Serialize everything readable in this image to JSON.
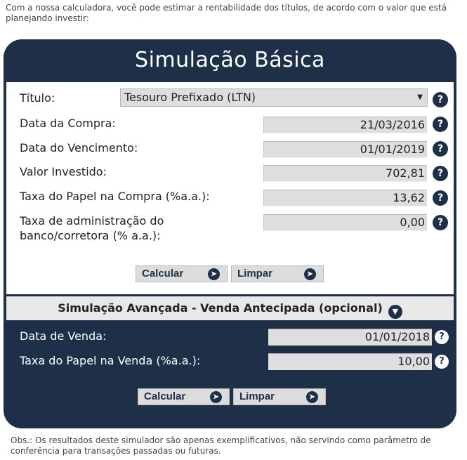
{
  "intro": "Com a nossa calculadora, você pode estimar a rentabilidade dos títulos, de acordo com o valor que está planejando investir:",
  "basic": {
    "title": "Simulação Básica",
    "titulo_label": "Título:",
    "titulo_value": "Tesouro Prefixado (LTN)",
    "data_compra_label": "Data da Compra:",
    "data_compra_value": "21/03/2016",
    "data_venc_label": "Data do Vencimento:",
    "data_venc_value": "01/01/2019",
    "valor_label": "Valor Investido:",
    "valor_value": "702,81",
    "taxa_label": "Taxa do Papel na Compra (%a.a.):",
    "taxa_value": "13,62",
    "admin_label_1": "Taxa de administração do",
    "admin_label_2": "banco/corretora (% a.a.):",
    "admin_value": "0,00",
    "help_glyph": "?",
    "calcular": "Calcular",
    "limpar": "Limpar"
  },
  "advanced": {
    "title": "Simulação Avançada - Venda Antecipada (opcional)",
    "data_venda_label": "Data de Venda:",
    "data_venda_value": "01/01/2018",
    "taxa_venda_label": "Taxa do Papel na Venda (%a.a.):",
    "taxa_venda_value": "10,00",
    "calcular": "Calcular",
    "limpar": "Limpar"
  },
  "obs": "Obs.: Os resultados deste simulador são apenas exemplificativos, não servindo como parâmetro de conferência para transações passadas ou futuras.",
  "icons": {
    "help": "question-circle-icon",
    "go": "chevron-right-circle-icon",
    "expand": "chevron-down-circle-icon",
    "select": "dropdown-arrow-icon"
  },
  "colors": {
    "panel": "#1d3047",
    "field": "#dedede",
    "adv_bar": "#e8e8e8"
  }
}
